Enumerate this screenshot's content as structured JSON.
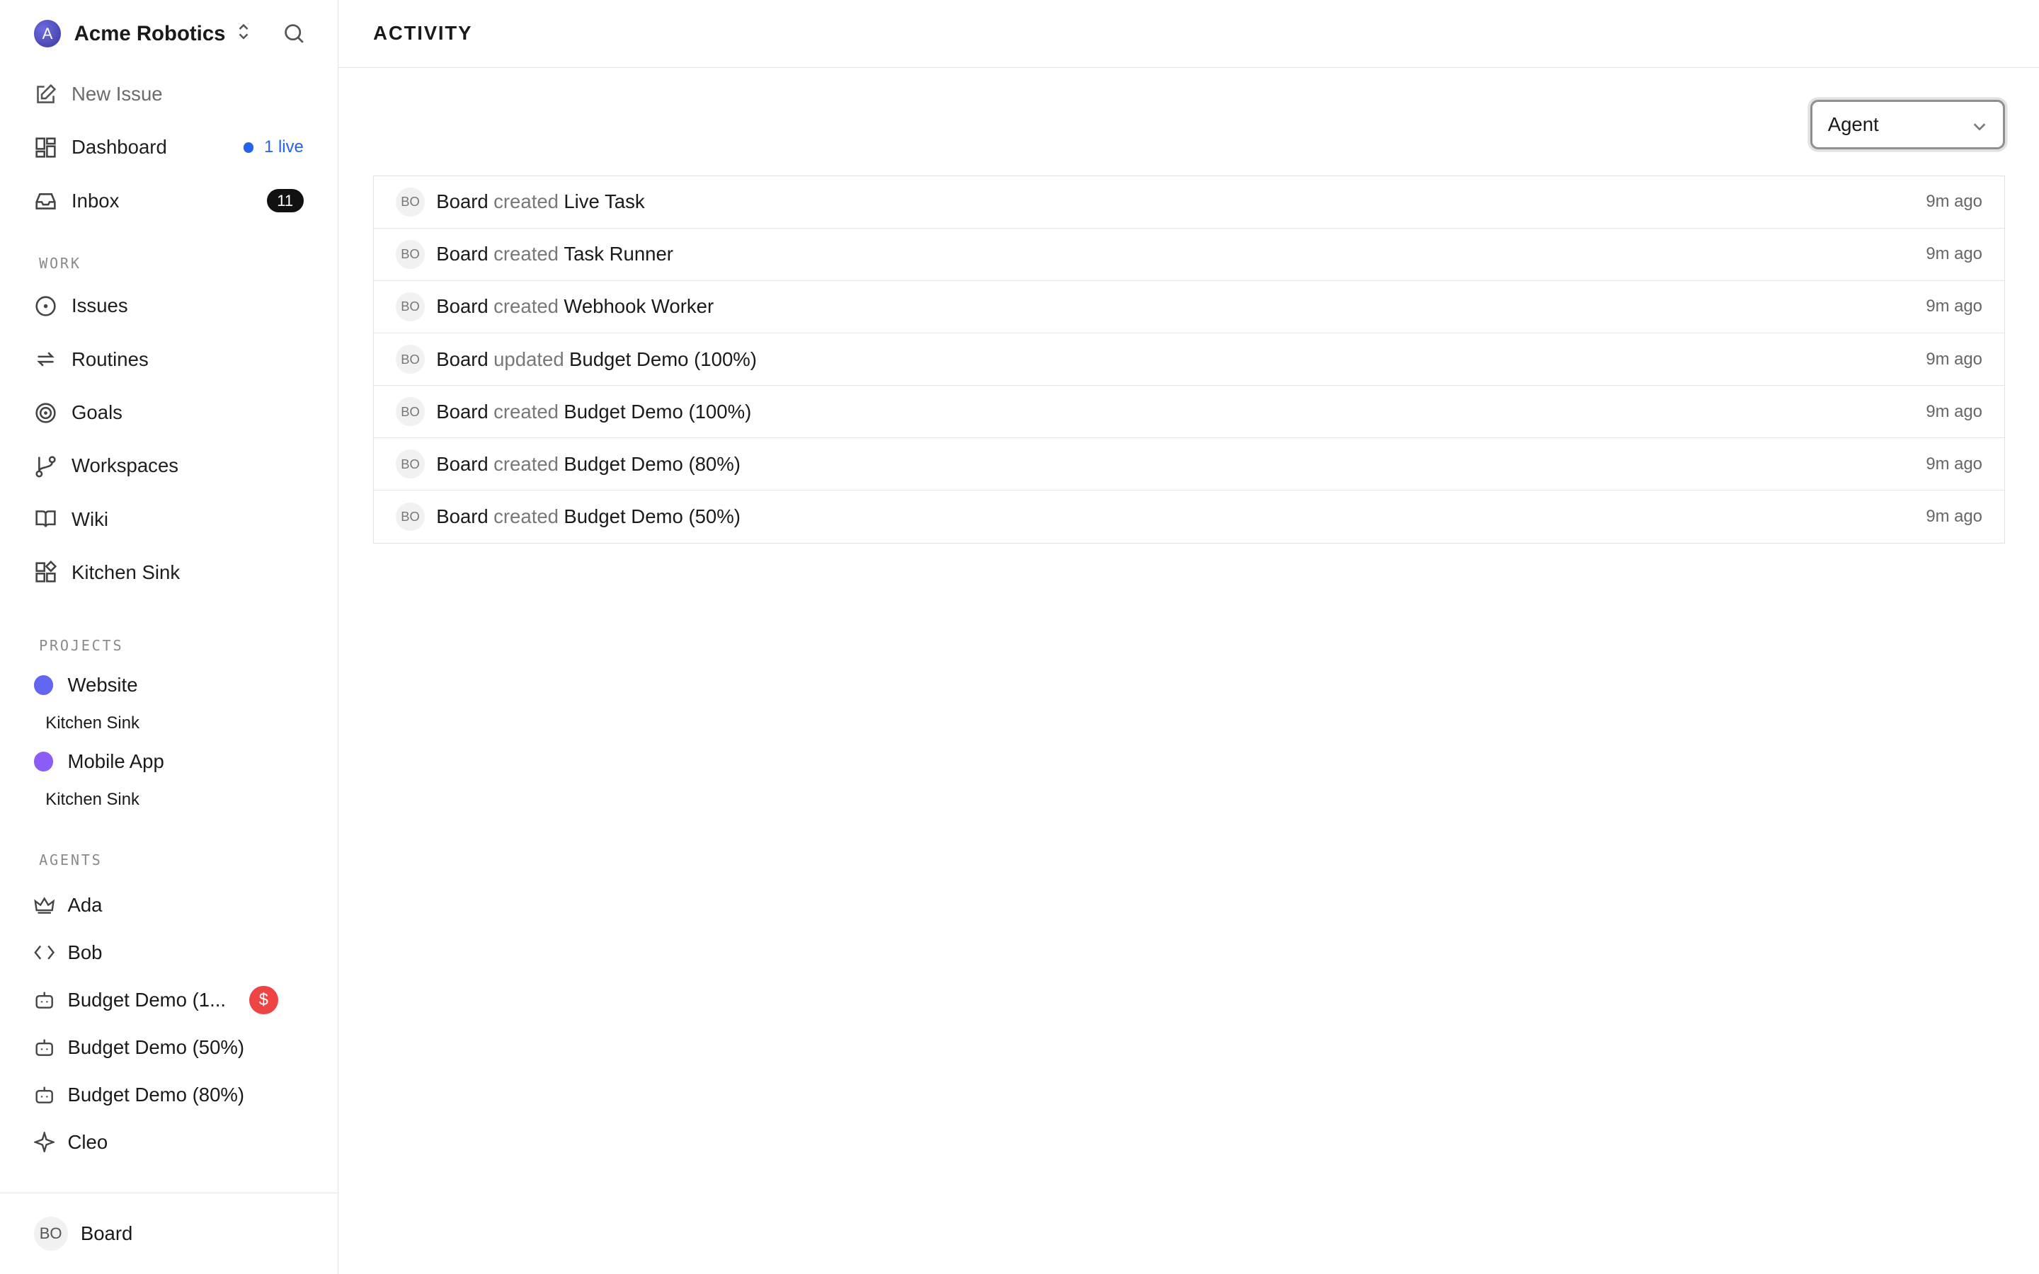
{
  "sidebar": {
    "org": {
      "initial": "A",
      "name": "Acme Robotics"
    },
    "nav": {
      "new_issue": "New Issue",
      "dashboard": "Dashboard",
      "dashboard_live": "1 live",
      "inbox": "Inbox",
      "inbox_count": "11"
    },
    "sections": {
      "work": "WORK",
      "projects": "PROJECTS",
      "agents": "AGENTS"
    },
    "work_items": [
      "Issues",
      "Routines",
      "Goals",
      "Workspaces",
      "Wiki",
      "Kitchen Sink"
    ],
    "projects": [
      {
        "name": "Website",
        "color": "#6366f1",
        "sub": "Kitchen Sink"
      },
      {
        "name": "Mobile App",
        "color": "#8b5cf6",
        "sub": "Kitchen Sink"
      }
    ],
    "agents": [
      {
        "name": "Ada",
        "icon": "crown-icon"
      },
      {
        "name": "Bob",
        "icon": "code-icon"
      },
      {
        "name": "Budget Demo (1...",
        "icon": "bot-icon",
        "badge": "$"
      },
      {
        "name": "Budget Demo (50%)",
        "icon": "bot-icon"
      },
      {
        "name": "Budget Demo (80%)",
        "icon": "bot-icon"
      },
      {
        "name": "Cleo",
        "icon": "sparkle-icon"
      }
    ],
    "footer": {
      "initials": "BO",
      "name": "Board"
    }
  },
  "main": {
    "title": "ACTIVITY",
    "filter": {
      "selected": "Agent"
    },
    "activity": [
      {
        "initials": "BO",
        "actor": "Board",
        "verb": "created",
        "target": "Live Task",
        "time": "9m ago"
      },
      {
        "initials": "BO",
        "actor": "Board",
        "verb": "created",
        "target": "Task Runner",
        "time": "9m ago"
      },
      {
        "initials": "BO",
        "actor": "Board",
        "verb": "created",
        "target": "Webhook Worker",
        "time": "9m ago"
      },
      {
        "initials": "BO",
        "actor": "Board",
        "verb": "updated",
        "target": "Budget Demo (100%)",
        "time": "9m ago"
      },
      {
        "initials": "BO",
        "actor": "Board",
        "verb": "created",
        "target": "Budget Demo (100%)",
        "time": "9m ago"
      },
      {
        "initials": "BO",
        "actor": "Board",
        "verb": "created",
        "target": "Budget Demo (80%)",
        "time": "9m ago"
      },
      {
        "initials": "BO",
        "actor": "Board",
        "verb": "created",
        "target": "Budget Demo (50%)",
        "time": "9m ago"
      }
    ]
  }
}
